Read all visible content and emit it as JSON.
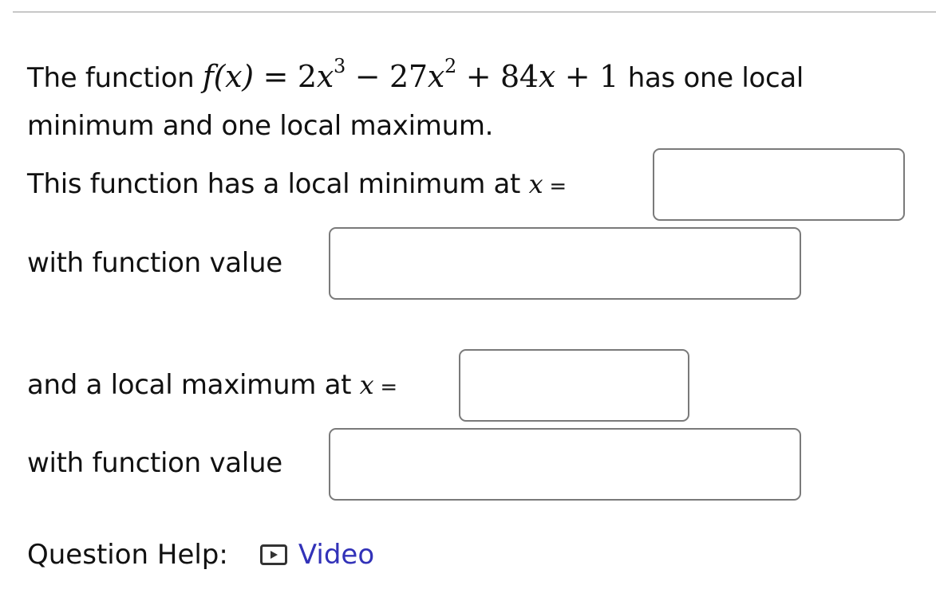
{
  "question": {
    "intro_before": "The function",
    "formula": {
      "lhs": "f(x)",
      "equals": "=",
      "term1_coef": "2",
      "term1_var": "x",
      "term1_exp": "3",
      "op1": "−",
      "term2_coef": "27",
      "term2_var": "x",
      "term2_exp": "2",
      "op2": "+",
      "term3_coef": "84",
      "term3_var": "x",
      "op3": "+",
      "term4": "1"
    },
    "intro_after": "has one local",
    "intro_line2": "minimum and one local maximum."
  },
  "parts": {
    "min_x_label": "This function has a local minimum at",
    "min_value_label": "with function value",
    "max_x_label": "and a local maximum at",
    "max_value_label": "with function value",
    "var": "x",
    "equals": "="
  },
  "inputs": {
    "min_x": "",
    "min_value": "",
    "max_x": "",
    "max_value": ""
  },
  "help": {
    "label": "Question Help:",
    "video_link": "Video",
    "icon": "video-play-icon"
  }
}
